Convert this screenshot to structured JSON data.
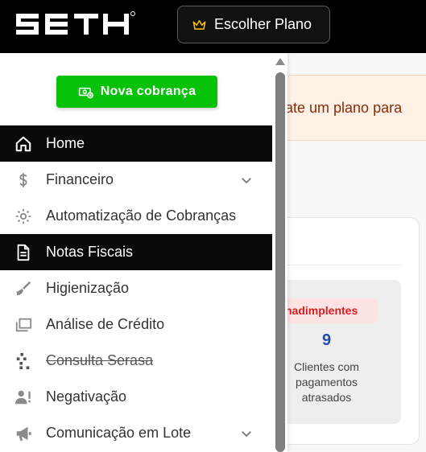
{
  "header": {
    "logo_text": "SETH",
    "plan_button": {
      "label": "Escolher Plano",
      "icon": "crown-icon"
    }
  },
  "main": {
    "banner_text": "rate um plano para",
    "card": {
      "badge": "nadimplentes",
      "count": "9",
      "description": "Clientes com pagamentos atrasados",
      "description_lines": [
        "Clientes com",
        "pagamentos",
        "atrasados"
      ]
    }
  },
  "sidebar": {
    "new_charge_button": {
      "label": "Nova cobrança",
      "icon": "money-add-icon"
    },
    "items": [
      {
        "label": "Home",
        "icon": "home-icon",
        "active": true,
        "has_submenu": false
      },
      {
        "label": "Financeiro",
        "icon": "dollar-icon",
        "active": false,
        "has_submenu": true
      },
      {
        "label": "Automatização de Cobranças",
        "icon": "gear-cog-icon",
        "active": false,
        "has_submenu": false
      },
      {
        "label": "Notas Fiscais",
        "icon": "document-icon",
        "active": true,
        "has_submenu": false
      },
      {
        "label": "Higienização",
        "icon": "broom-icon",
        "active": false,
        "has_submenu": false
      },
      {
        "label": "Análise de Crédito",
        "icon": "cards-icon",
        "active": false,
        "has_submenu": false
      },
      {
        "label": "Consulta Serasa",
        "icon": "serasa-icon",
        "active": false,
        "has_submenu": false
      },
      {
        "label": "Negativação",
        "icon": "user-alert-icon",
        "active": false,
        "has_submenu": false
      },
      {
        "label": "Comunicação em Lote",
        "icon": "megaphone-icon",
        "active": false,
        "has_submenu": true
      }
    ]
  },
  "colors": {
    "topbar": "#000000",
    "green_button": "#08c20a",
    "active_item": "#0a0a0a",
    "crown": "#f5b80e",
    "badge_text": "#d91e1e",
    "count_text": "#1b4fa8"
  }
}
